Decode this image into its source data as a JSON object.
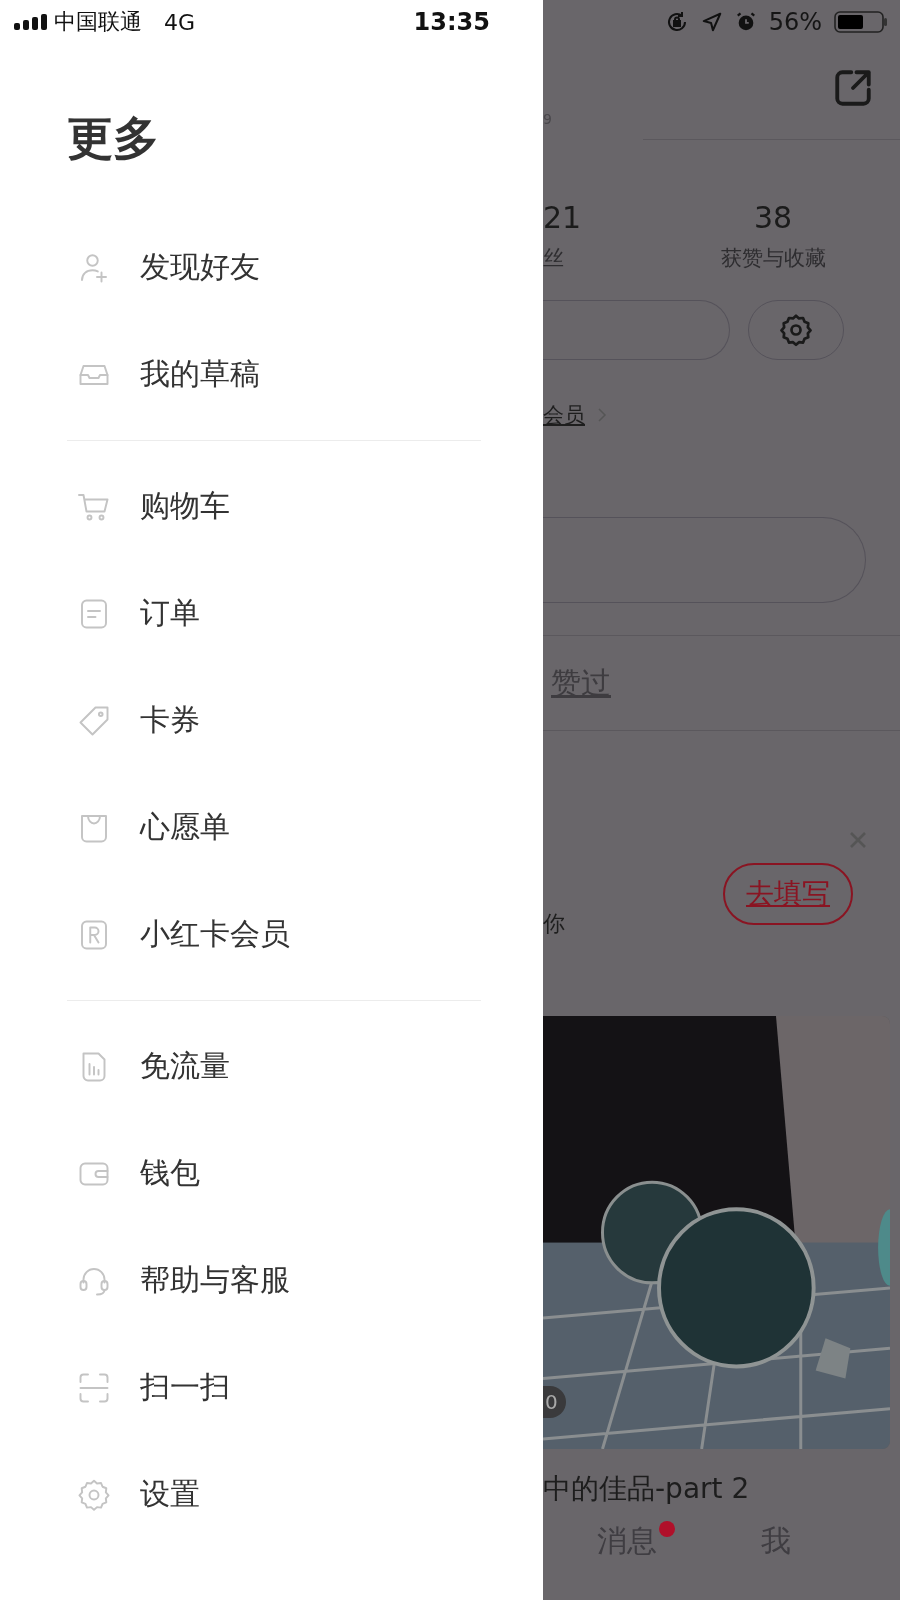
{
  "status_bar": {
    "carrier": "中国联通",
    "network": "4G",
    "time": "13:35",
    "battery": "56%"
  },
  "drawer": {
    "title": "更多",
    "sections": [
      [
        {
          "kind": "add-user",
          "label": "发现好友"
        },
        {
          "kind": "inbox",
          "label": "我的草稿"
        }
      ],
      [
        {
          "kind": "cart",
          "label": "购物车"
        },
        {
          "kind": "order",
          "label": "订单"
        },
        {
          "kind": "coupon",
          "label": "卡券"
        },
        {
          "kind": "bag",
          "label": "心愿单"
        },
        {
          "kind": "r-badge",
          "label": "小红卡会员"
        }
      ],
      [
        {
          "kind": "data",
          "label": "免流量"
        },
        {
          "kind": "wallet",
          "label": "钱包"
        },
        {
          "kind": "headset",
          "label": "帮助与客服"
        },
        {
          "kind": "scan",
          "label": "扫一扫"
        },
        {
          "kind": "gear",
          "label": "设置"
        }
      ]
    ]
  },
  "profile": {
    "id_fragment": "9",
    "stats": [
      {
        "value": "21",
        "label": "丝"
      },
      {
        "value": "38",
        "label": "获赞与收藏"
      }
    ],
    "member_link": "会员",
    "tab": "赞过",
    "prompt_text": "你",
    "prompt_button": "去填写",
    "note": {
      "badge": "0",
      "title": "中的佳品-part 2"
    },
    "tab_bar": [
      {
        "label": "消息",
        "badge": true
      },
      {
        "label": "我",
        "badge": false
      }
    ]
  }
}
